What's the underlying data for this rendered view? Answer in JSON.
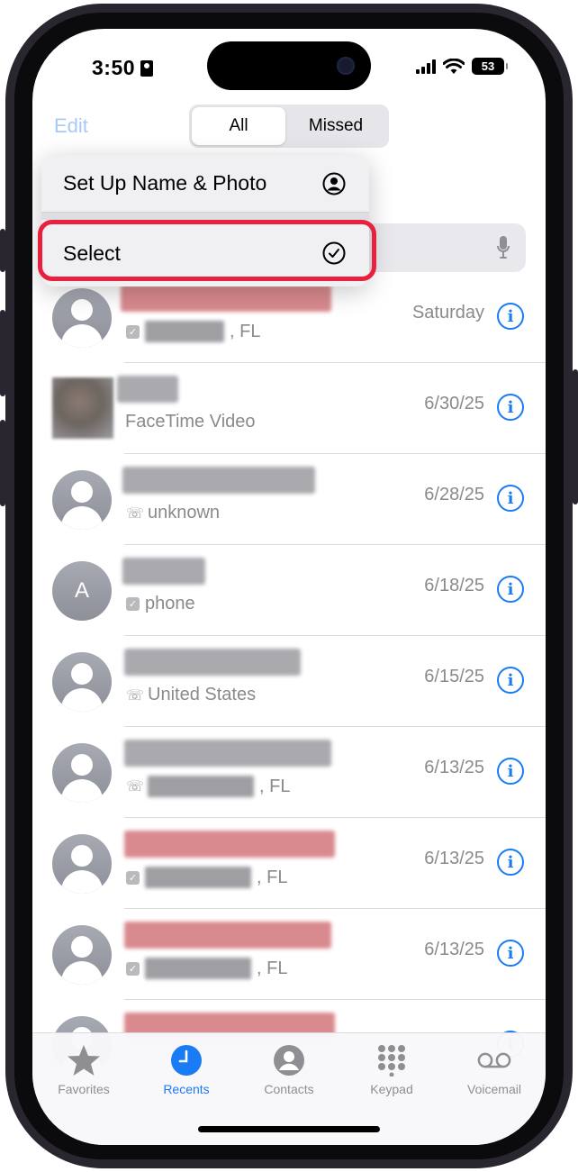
{
  "status_bar": {
    "time": "3:50",
    "battery": "53"
  },
  "header": {
    "edit_label": "Edit",
    "segments": [
      "All",
      "Missed"
    ]
  },
  "menu": {
    "items": [
      {
        "label": "Set Up Name & Photo",
        "icon": "person-circle-icon"
      },
      {
        "label": "Select",
        "icon": "checkmark-circle-icon"
      }
    ]
  },
  "calls": [
    {
      "avatar": "person",
      "detail_icon": "checkbox",
      "detail": ", FL",
      "date": "Saturday"
    },
    {
      "avatar": "photo",
      "detail_icon": "",
      "detail": "FaceTime Video",
      "date": "6/30/25"
    },
    {
      "avatar": "person",
      "detail_icon": "phone-outgoing",
      "detail": "unknown",
      "date": "6/28/25"
    },
    {
      "avatar": "letter",
      "letter": "A",
      "detail_icon": "checkbox",
      "detail": "phone",
      "date": "6/18/25"
    },
    {
      "avatar": "person",
      "detail_icon": "phone-outgoing",
      "detail": "United States",
      "date": "6/15/25"
    },
    {
      "avatar": "person",
      "detail_icon": "phone-outgoing",
      "detail": ", FL",
      "date": "6/13/25"
    },
    {
      "avatar": "person",
      "detail_icon": "checkbox",
      "detail": ", FL",
      "date": "6/13/25"
    },
    {
      "avatar": "person",
      "detail_icon": "checkbox",
      "detail": ", FL",
      "date": "6/13/25"
    }
  ],
  "tab_bar": {
    "tabs": [
      {
        "label": "Favorites",
        "icon": "star-icon"
      },
      {
        "label": "Recents",
        "icon": "clock-icon"
      },
      {
        "label": "Contacts",
        "icon": "person-circle-icon"
      },
      {
        "label": "Keypad",
        "icon": "keypad-icon"
      },
      {
        "label": "Voicemail",
        "icon": "voicemail-icon"
      }
    ],
    "active": "Recents"
  },
  "colors": {
    "accent": "#1a7cf5",
    "highlight": "#e8223e"
  }
}
